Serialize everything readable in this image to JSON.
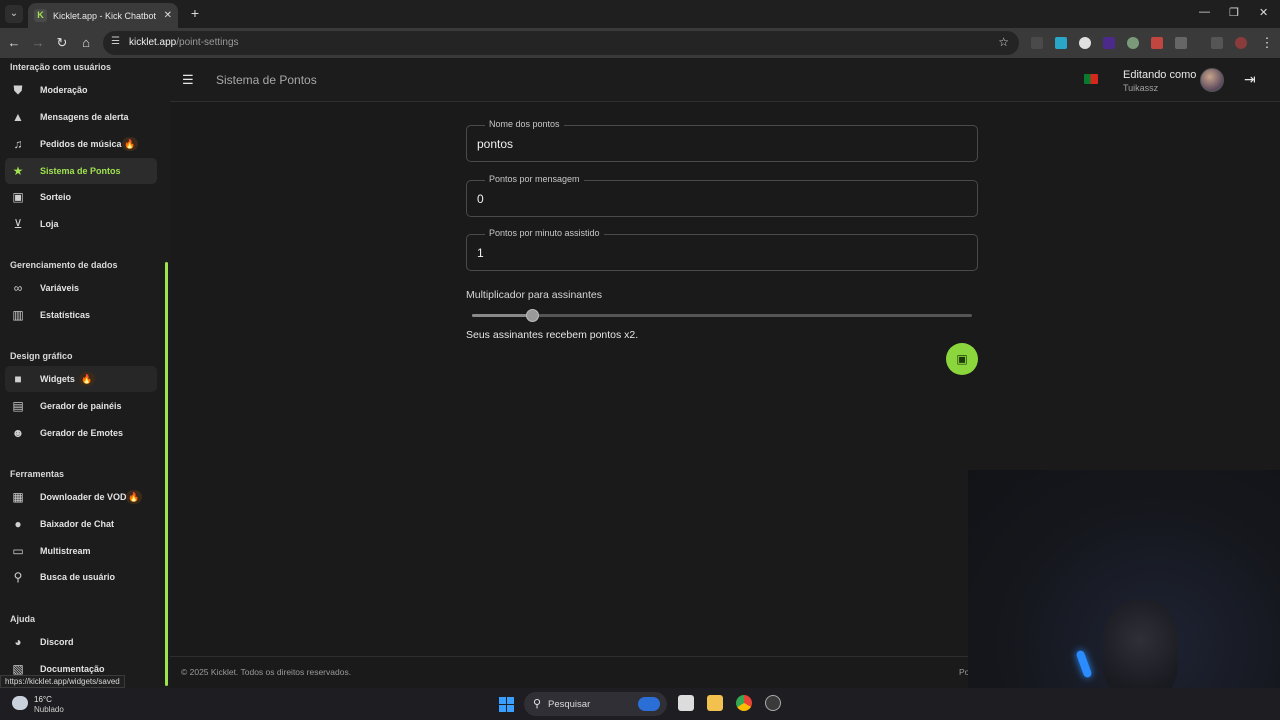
{
  "browser": {
    "tab_title": "Kicklet.app - Kick Chatbot and",
    "url_host": "kicklet.app",
    "url_path": "/point-settings"
  },
  "sidebar": {
    "sections": [
      {
        "title": "Interação com usuários",
        "items": [
          {
            "label": "Moderação",
            "icon": "shield-icon"
          },
          {
            "label": "Mensagens de alerta",
            "icon": "warning-icon"
          },
          {
            "label": "Pedidos de música",
            "icon": "music-icon",
            "badge": "🔥"
          },
          {
            "label": "Sistema de Pontos",
            "icon": "star-icon",
            "active": true
          },
          {
            "label": "Sorteio",
            "icon": "gift-icon"
          },
          {
            "label": "Loja",
            "icon": "cart-icon"
          }
        ]
      },
      {
        "title": "Gerenciamento de dados",
        "items": [
          {
            "label": "Variáveis",
            "icon": "link-icon"
          },
          {
            "label": "Estatísticas",
            "icon": "bar-chart-icon"
          }
        ]
      },
      {
        "title": "Design gráfico",
        "items": [
          {
            "label": "Widgets",
            "icon": "video-icon",
            "badge": "🔥"
          },
          {
            "label": "Gerador de painéis",
            "icon": "panel-icon"
          },
          {
            "label": "Gerador de Emotes",
            "icon": "emoji-icon"
          }
        ]
      },
      {
        "title": "Ferramentas",
        "items": [
          {
            "label": "Downloader de VOD",
            "icon": "film-icon",
            "badge": "🔥"
          },
          {
            "label": "Baixador de Chat",
            "icon": "chat-icon"
          },
          {
            "label": "Multistream",
            "icon": "monitor-icon"
          },
          {
            "label": "Busca de usuário",
            "icon": "search-icon"
          }
        ]
      },
      {
        "title": "Ajuda",
        "items": [
          {
            "label": "Discord",
            "icon": "discord-icon"
          },
          {
            "label": "Documentação",
            "icon": "doc-icon"
          }
        ]
      }
    ]
  },
  "header": {
    "title": "Sistema de Pontos",
    "editing_label": "Editando como",
    "editing_user": "Tuikassz"
  },
  "form": {
    "name_label": "Nome dos pontos",
    "name_value": "pontos",
    "per_message_label": "Pontos por mensagem",
    "per_message_value": "0",
    "per_minute_label": "Pontos por minuto assistido",
    "per_minute_value": "1",
    "multiplier_label": "Multiplicador para assinantes",
    "multiplier_fraction": 0.12,
    "multiplier_note": "Seus assinantes recebem pontos x2."
  },
  "footer": {
    "text": "© 2025 Kicklet. Todos os direitos reservados.",
    "right": "Po"
  },
  "status_url": "https://kicklet.app/widgets/saved",
  "taskbar": {
    "temp": "16°C",
    "weather": "Nublado",
    "search_placeholder": "Pesquisar"
  },
  "colors": {
    "accent": "#9fe34f",
    "save_button": "#8bd63d"
  }
}
